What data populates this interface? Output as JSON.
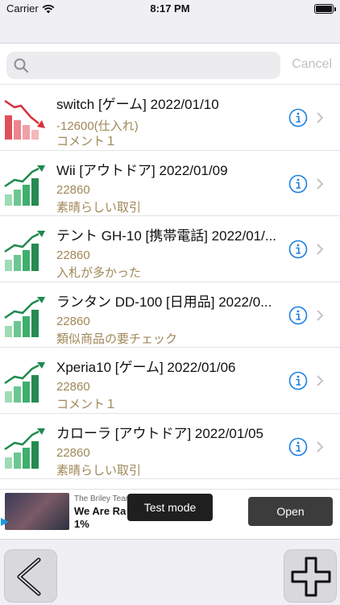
{
  "status_bar": {
    "carrier": "Carrier",
    "time": "8:17 PM"
  },
  "search": {
    "placeholder": "",
    "value": "",
    "cancel_label": "Cancel"
  },
  "records": [
    {
      "title": "switch [ゲーム]  2022/01/10",
      "amount": "-12600(仕入れ)",
      "comment": "コメント１",
      "trend": "down",
      "icon": "trend-down-chart-icon"
    },
    {
      "title": "Wii [アウトドア]  2022/01/09",
      "amount": "22860",
      "comment": "素晴らしい取引",
      "trend": "up",
      "icon": "trend-up-chart-icon"
    },
    {
      "title": "テント GH-10 [携帯電話]  2022/01/...",
      "amount": "22860",
      "comment": "入札が多かった",
      "trend": "up",
      "icon": "trend-up-chart-icon"
    },
    {
      "title": "ランタン DD-100 [日用品]  2022/0...",
      "amount": "22860",
      "comment": "類似商品の要チェック",
      "trend": "up",
      "icon": "trend-up-chart-icon"
    },
    {
      "title": "Xperia10 [ゲーム]  2022/01/06",
      "amount": "22860",
      "comment": "コメント１",
      "trend": "up",
      "icon": "trend-up-chart-icon"
    },
    {
      "title": "カローラ [アウトドア]  2022/01/05",
      "amount": "22860",
      "comment": "素晴らしい取引",
      "trend": "up",
      "icon": "trend-up-chart-icon"
    }
  ],
  "ad": {
    "advertiser": "The Briley Tean",
    "headline": "We Are Ra",
    "subline": "1%",
    "test_mode_label": "Test mode",
    "open_label": "Open"
  },
  "toolbar": {
    "back_icon": "chevron-left-icon",
    "add_icon": "plus-icon"
  },
  "colors": {
    "accent": "#1a7fe0",
    "amount_text": "#a08858",
    "trend_up": "#2e9e5f",
    "trend_down": "#e0505a",
    "bar_background": "#efeff4"
  }
}
